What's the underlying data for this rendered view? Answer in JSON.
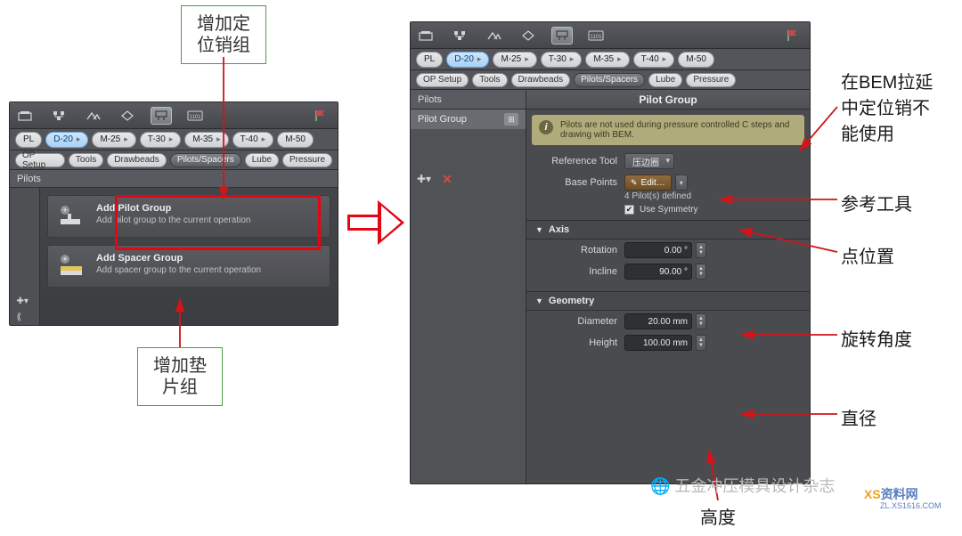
{
  "callouts": {
    "top": "增加定\n位销组",
    "bottom": "增加垫\n片组"
  },
  "side_labels": {
    "bem": "在BEM拉延\n中定位销不\n能使用",
    "reftool": "参考工具",
    "points": "点位置",
    "rotation": "旋转角度",
    "diameter": "直径",
    "height": "高度"
  },
  "left_panel": {
    "tabs": [
      "PL",
      "D-20",
      "M-25",
      "T-30",
      "M-35",
      "T-40",
      "M-50"
    ],
    "active_tab": "D-20",
    "subtabs": [
      "OP Setup",
      "Tools",
      "Drawbeads",
      "Pilots/Spacers",
      "Lube",
      "Pressure"
    ],
    "active_subtab": "Pilots/Spacers",
    "section_title": "Pilots",
    "add_pilot": {
      "title": "Add Pilot Group",
      "desc": "Add pilot group to the current operation"
    },
    "add_spacer": {
      "title": "Add Spacer Group",
      "desc": "Add spacer group to the current operation"
    }
  },
  "right_panel": {
    "tabs": [
      "PL",
      "D-20",
      "M-25",
      "T-30",
      "M-35",
      "T-40",
      "M-50"
    ],
    "active_tab": "D-20",
    "subtabs": [
      "OP Setup",
      "Tools",
      "Drawbeads",
      "Pilots/Spacers",
      "Lube",
      "Pressure"
    ],
    "active_subtab": "Pilots/Spacers",
    "nav_header": "Pilots",
    "nav_item": "Pilot Group",
    "props_title": "Pilot Group",
    "info_text": "Pilots are not used during pressure controlled C steps and drawing with BEM.",
    "ref_tool_label": "Reference Tool",
    "ref_tool_value": "压边圈",
    "base_points_label": "Base Points",
    "edit_label": "Edit…",
    "defined_note": "4 Pilot(s) defined",
    "use_symmetry": "Use Symmetry",
    "axis_group": "Axis",
    "rotation_label": "Rotation",
    "rotation_value": "0.00 °",
    "incline_label": "Incline",
    "incline_value": "90.00 °",
    "geometry_group": "Geometry",
    "diameter_label": "Diameter",
    "diameter_value": "20.00 mm",
    "height_label": "Height",
    "height_value": "100.00 mm"
  },
  "watermarks": {
    "wm1_prefix": "🌐 ",
    "wm1": "五金冲压模具设计杂志",
    "wm2_prefix": "XS",
    "wm2": "资料网",
    "wm2_sub": "ZL.XS1616.COM"
  }
}
